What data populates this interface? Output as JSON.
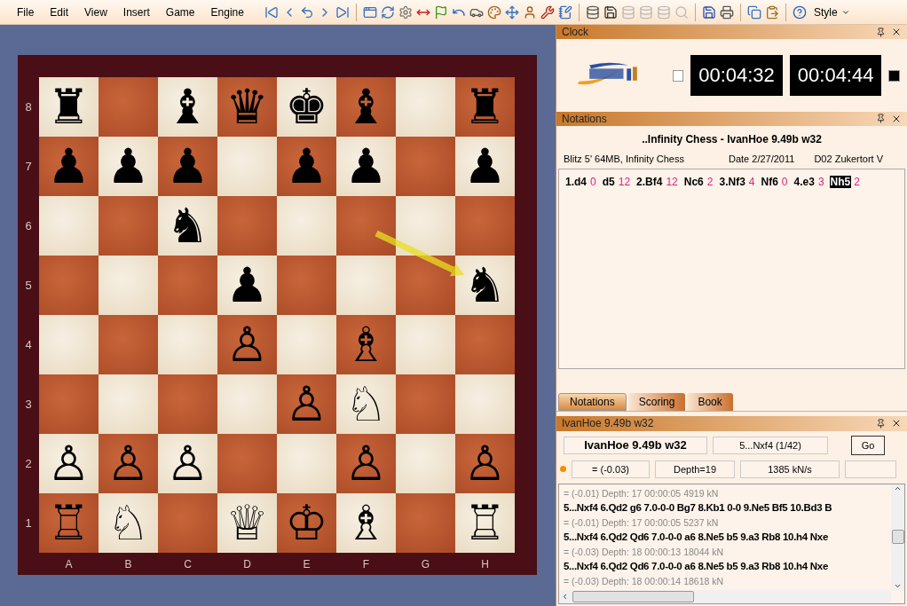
{
  "menu": [
    "File",
    "Edit",
    "View",
    "Insert",
    "Game",
    "Engine"
  ],
  "toolbar": {
    "style_label": "Style"
  },
  "board": {
    "ranks": [
      "8",
      "7",
      "6",
      "5",
      "4",
      "3",
      "2",
      "1"
    ],
    "files": [
      "A",
      "B",
      "C",
      "D",
      "E",
      "F",
      "G",
      "H"
    ],
    "rows": [
      [
        {
          "piece": "♜"
        },
        {},
        {
          "piece": "♝"
        },
        {
          "piece": "♛"
        },
        {
          "piece": "♚"
        },
        {
          "piece": "♝"
        },
        {},
        {
          "piece": "♜"
        }
      ],
      [
        {
          "piece": "♟"
        },
        {
          "piece": "♟"
        },
        {
          "piece": "♟"
        },
        {},
        {
          "piece": "♟"
        },
        {
          "piece": "♟"
        },
        {},
        {
          "piece": "♟"
        }
      ],
      [
        {},
        {},
        {
          "piece": "♞"
        },
        {},
        {},
        {},
        {},
        {}
      ],
      [
        {},
        {},
        {},
        {
          "piece": "♟"
        },
        {},
        {},
        {},
        {
          "piece": "♞"
        }
      ],
      [
        {},
        {},
        {},
        {
          "piece": "♙"
        },
        {},
        {
          "piece": "♗"
        },
        {},
        {}
      ],
      [
        {},
        {},
        {},
        {},
        {
          "piece": "♙"
        },
        {
          "piece": "♘"
        },
        {},
        {}
      ],
      [
        {
          "piece": "♙"
        },
        {
          "piece": "♙"
        },
        {
          "piece": "♙"
        },
        {},
        {},
        {
          "piece": "♙"
        },
        {},
        {
          "piece": "♙"
        }
      ],
      [
        {
          "piece": "♖"
        },
        {
          "piece": "♘"
        },
        {},
        {
          "piece": "♕"
        },
        {
          "piece": "♔"
        },
        {
          "piece": "♗"
        },
        {},
        {
          "piece": "♖"
        }
      ]
    ]
  },
  "clock": {
    "title": "Clock",
    "white_time": "00:04:32",
    "black_time": "00:04:44",
    "white_to_move": false,
    "black_to_move": true
  },
  "notations": {
    "title": "Notations",
    "game_title": "..Infinity Chess -  IvanHoe 9.49b w32",
    "event": "Blitz 5'  64MB, Infinity Chess",
    "date": "Date  2/27/2011",
    "opening": "D02 Zukertort V",
    "moves": [
      {
        "move": "1.d4",
        "time": "0",
        "selected": false
      },
      {
        "move": "d5",
        "time": "12",
        "selected": false
      },
      {
        "move": "2.Bf4",
        "time": "12",
        "selected": false
      },
      {
        "move": "Nc6",
        "time": "2",
        "selected": false
      },
      {
        "move": "3.Nf3",
        "time": "4",
        "selected": false
      },
      {
        "move": "Nf6",
        "time": "0",
        "selected": false
      },
      {
        "move": "4.e3",
        "time": "3",
        "selected": false
      },
      {
        "move": "Nh5",
        "time": "2",
        "selected": true
      }
    ]
  },
  "tabs": [
    {
      "label": "Notations",
      "selected": true
    },
    {
      "label": "Scoring",
      "selected": false
    },
    {
      "label": "Book",
      "selected": false
    }
  ],
  "engine": {
    "title": "IvanHoe 9.49b w32",
    "name": "IvanHoe 9.49b w32",
    "current_move": "5...Nxf4 (1/42)",
    "go_label": "Go",
    "score": "= (-0.03)",
    "depth": "Depth=19",
    "speed": "1385 kN/s",
    "output": [
      {
        "kind": "eval",
        "text": "= (-0.01)  Depth: 17  00:00:05  4919 kN"
      },
      {
        "kind": "line",
        "text": "5...Nxf4 6.Qd2  g6 7.0-0-0  Bg7 8.Kb1  0-0 9.Ne5  Bf5 10.Bd3  B"
      },
      {
        "kind": "eval",
        "text": "= (-0.01)  Depth: 17  00:00:05  5237 kN"
      },
      {
        "kind": "line",
        "text": "5...Nxf4 6.Qd2  Qd6 7.0-0-0  a6 8.Ne5  b5 9.a3  Rb8 10.h4  Nxe"
      },
      {
        "kind": "eval",
        "text": "= (-0.03)  Depth: 18  00:00:13  18044 kN"
      },
      {
        "kind": "line",
        "text": "5...Nxf4 6.Qd2  Qd6 7.0-0-0  a6 8.Ne5  b5 9.a3  Rb8 10.h4  Nxe"
      },
      {
        "kind": "eval",
        "text": "= (-0.03)  Depth: 18  00:00:14  18618 kN"
      }
    ]
  }
}
